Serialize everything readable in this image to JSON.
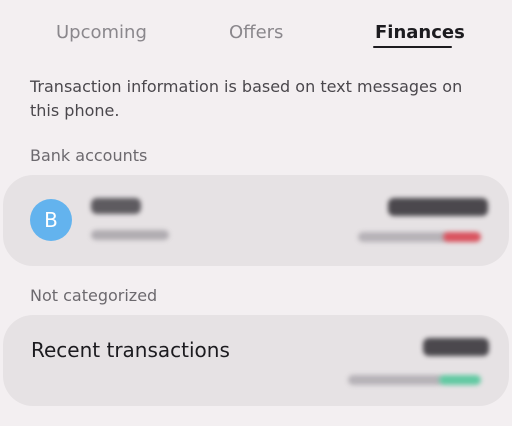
{
  "tabs": [
    {
      "label": "Upcoming",
      "selected": false
    },
    {
      "label": "Offers",
      "selected": false
    },
    {
      "label": "Finances",
      "selected": true
    }
  ],
  "info_text": "Transaction information is based on text messages on this phone.",
  "bank_accounts": {
    "section_label": "Bank accounts",
    "account": {
      "avatar_letter": "B",
      "avatar_color": "#63b3ee",
      "name": "",
      "subtitle": "",
      "amount": ""
    }
  },
  "not_categorized": {
    "section_label": "Not categorized",
    "recent": {
      "title": "Recent transactions",
      "amount": ""
    }
  },
  "colors": {
    "background": "#f3eff1",
    "card": "#e6e2e4",
    "negative": "#d9535e",
    "positive": "#62c9a2"
  }
}
